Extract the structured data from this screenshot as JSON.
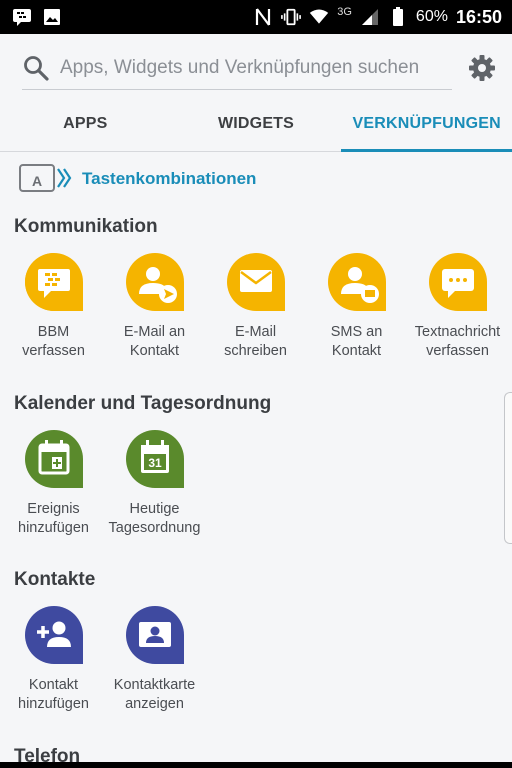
{
  "status_bar": {
    "network": "3G",
    "battery": "60%",
    "time": "16:50"
  },
  "search": {
    "placeholder": "Apps, Widgets und Verknüpfungen suchen"
  },
  "tabs": [
    {
      "label": "APPS",
      "active": false
    },
    {
      "label": "WIDGETS",
      "active": false
    },
    {
      "label": "VERKNÜPFUNGEN",
      "active": true
    }
  ],
  "shortcut_link": {
    "label": "Tastenkombinationen"
  },
  "sections": [
    {
      "title": "Kommunikation",
      "items": [
        {
          "label": "BBM\nverfassen",
          "icon": "bbm-chat-icon"
        },
        {
          "label": "E-Mail an\nKontakt",
          "icon": "contact-send-icon"
        },
        {
          "label": "E-Mail\nschreiben",
          "icon": "envelope-icon"
        },
        {
          "label": "SMS an\nKontakt",
          "icon": "contact-sms-icon"
        },
        {
          "label": "Textnachricht\nverfassen",
          "icon": "message-bubble-icon"
        }
      ]
    },
    {
      "title": "Kalender und Tagesordnung",
      "items": [
        {
          "label": "Ereignis\nhinzufügen",
          "icon": "calendar-add-icon"
        },
        {
          "label": "Heutige\nTagesordnung",
          "icon": "calendar-31-icon",
          "day": "31"
        }
      ]
    },
    {
      "title": "Kontakte",
      "items": [
        {
          "label": "Kontakt\nhinzufügen",
          "icon": "add-person-icon"
        },
        {
          "label": "Kontaktkarte\nanzeigen",
          "icon": "contact-card-icon"
        }
      ]
    },
    {
      "title": "Telefon",
      "items": []
    }
  ],
  "colors": {
    "accent": "#1a8db8",
    "communication": "#f5b400",
    "calendar": "#5a8a2c",
    "contacts": "#3f4aa0"
  }
}
